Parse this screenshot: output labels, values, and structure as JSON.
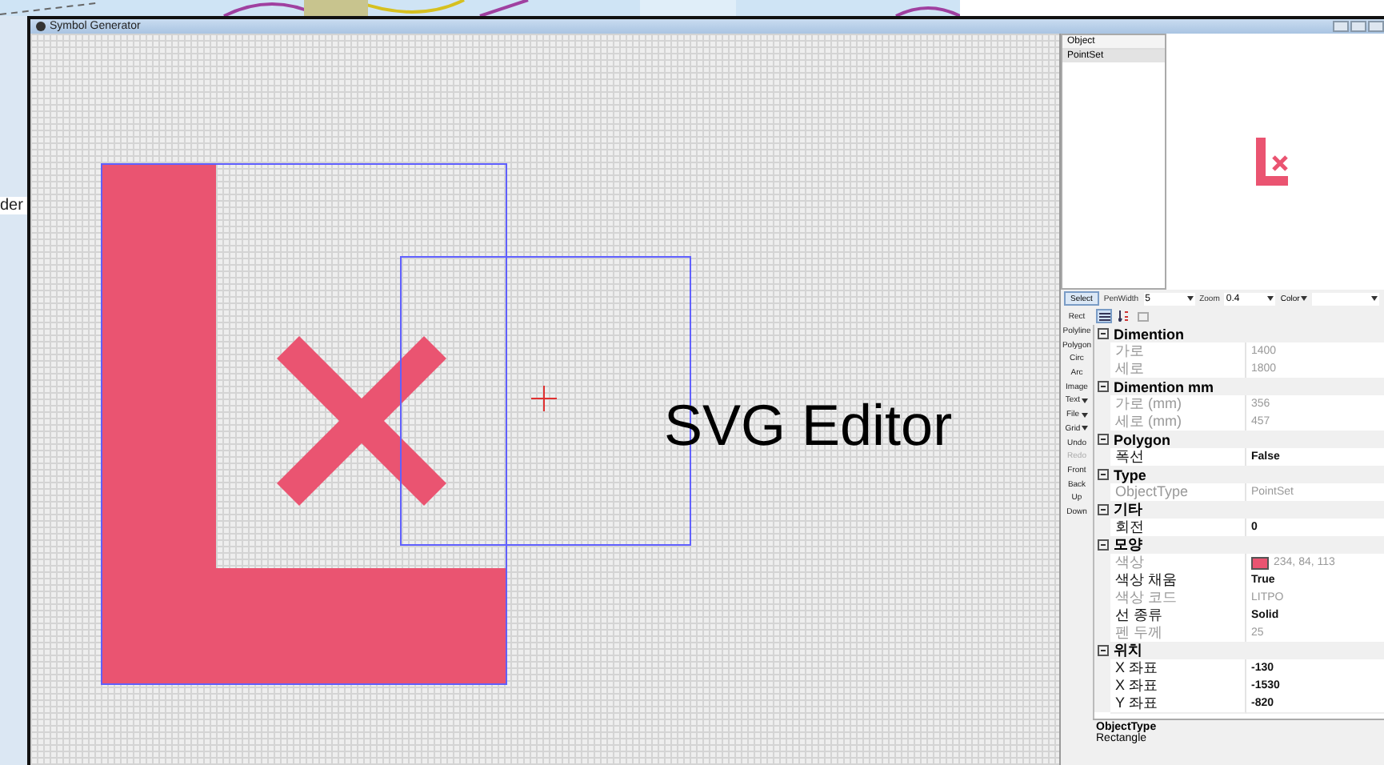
{
  "window": {
    "title": "Symbol Generator"
  },
  "background_window": {
    "text": "der"
  },
  "canvas": {
    "overlay_text": "SVG Editor"
  },
  "object_list": {
    "column": "Object",
    "rows": [
      {
        "label": "PointSet",
        "selected": true
      }
    ]
  },
  "toolbar": {
    "select_button": "Select",
    "pen_width": {
      "label": "PenWidth",
      "value": "5"
    },
    "zoom": {
      "label": "Zoom",
      "value": "0.4"
    },
    "color": {
      "label": "Color"
    }
  },
  "tools": [
    {
      "label": "Rect",
      "disabled": false,
      "dropdown": false
    },
    {
      "label": "Polyline",
      "disabled": false,
      "dropdown": false
    },
    {
      "label": "Polygon",
      "disabled": false,
      "dropdown": false
    },
    {
      "label": "Circ",
      "disabled": false,
      "dropdown": false
    },
    {
      "label": "Arc",
      "disabled": false,
      "dropdown": false
    },
    {
      "label": "Image",
      "disabled": false,
      "dropdown": false
    },
    {
      "label": "Text",
      "disabled": false,
      "dropdown": true
    },
    {
      "label": "File",
      "disabled": false,
      "dropdown": true
    },
    {
      "label": "Grid",
      "disabled": false,
      "dropdown": true
    },
    {
      "label": "Undo",
      "disabled": false,
      "dropdown": false
    },
    {
      "label": "Redo",
      "disabled": true,
      "dropdown": false
    },
    {
      "label": "Front",
      "disabled": false,
      "dropdown": false
    },
    {
      "label": "Back",
      "disabled": false,
      "dropdown": false
    },
    {
      "label": "Up",
      "disabled": false,
      "dropdown": false
    },
    {
      "label": "Down",
      "disabled": false,
      "dropdown": false
    }
  ],
  "property_sort": {
    "categorized": true
  },
  "properties": [
    {
      "category": "Dimention",
      "rows": [
        {
          "name": "가로",
          "value": "1400",
          "readonly": true
        },
        {
          "name": "세로",
          "value": "1800",
          "readonly": true
        }
      ]
    },
    {
      "category": "Dimention mm",
      "rows": [
        {
          "name": "가로 (mm)",
          "value": "356",
          "readonly": true
        },
        {
          "name": "세로 (mm)",
          "value": "457",
          "readonly": true
        }
      ]
    },
    {
      "category": "Polygon",
      "rows": [
        {
          "name": "폭선",
          "value": "False",
          "readonly": false
        }
      ]
    },
    {
      "category": "Type",
      "rows": [
        {
          "name": "ObjectType",
          "value": "PointSet",
          "readonly": true
        }
      ]
    },
    {
      "category": "기타",
      "rows": [
        {
          "name": "회전",
          "value": "0",
          "readonly": false
        }
      ]
    },
    {
      "category": "모양",
      "rows": [
        {
          "name": "색상",
          "value": "234, 84, 113",
          "readonly": true,
          "color": "#ea5471"
        },
        {
          "name": "색상 채움",
          "value": "True",
          "readonly": false
        },
        {
          "name": "색상 코드",
          "value": "LITPO",
          "readonly": true
        },
        {
          "name": "선 종류",
          "value": "Solid",
          "readonly": false
        },
        {
          "name": "펜 두께",
          "value": "25",
          "readonly": true
        }
      ]
    },
    {
      "category": "위치",
      "rows": [
        {
          "name": "X 좌표",
          "value": "-130",
          "readonly": false
        },
        {
          "name": "X 좌표",
          "value": "-1530",
          "readonly": false
        },
        {
          "name": "Y 좌표",
          "value": "-820",
          "readonly": false
        }
      ]
    }
  ],
  "description": {
    "title": "ObjectType",
    "text": "Rectangle"
  }
}
